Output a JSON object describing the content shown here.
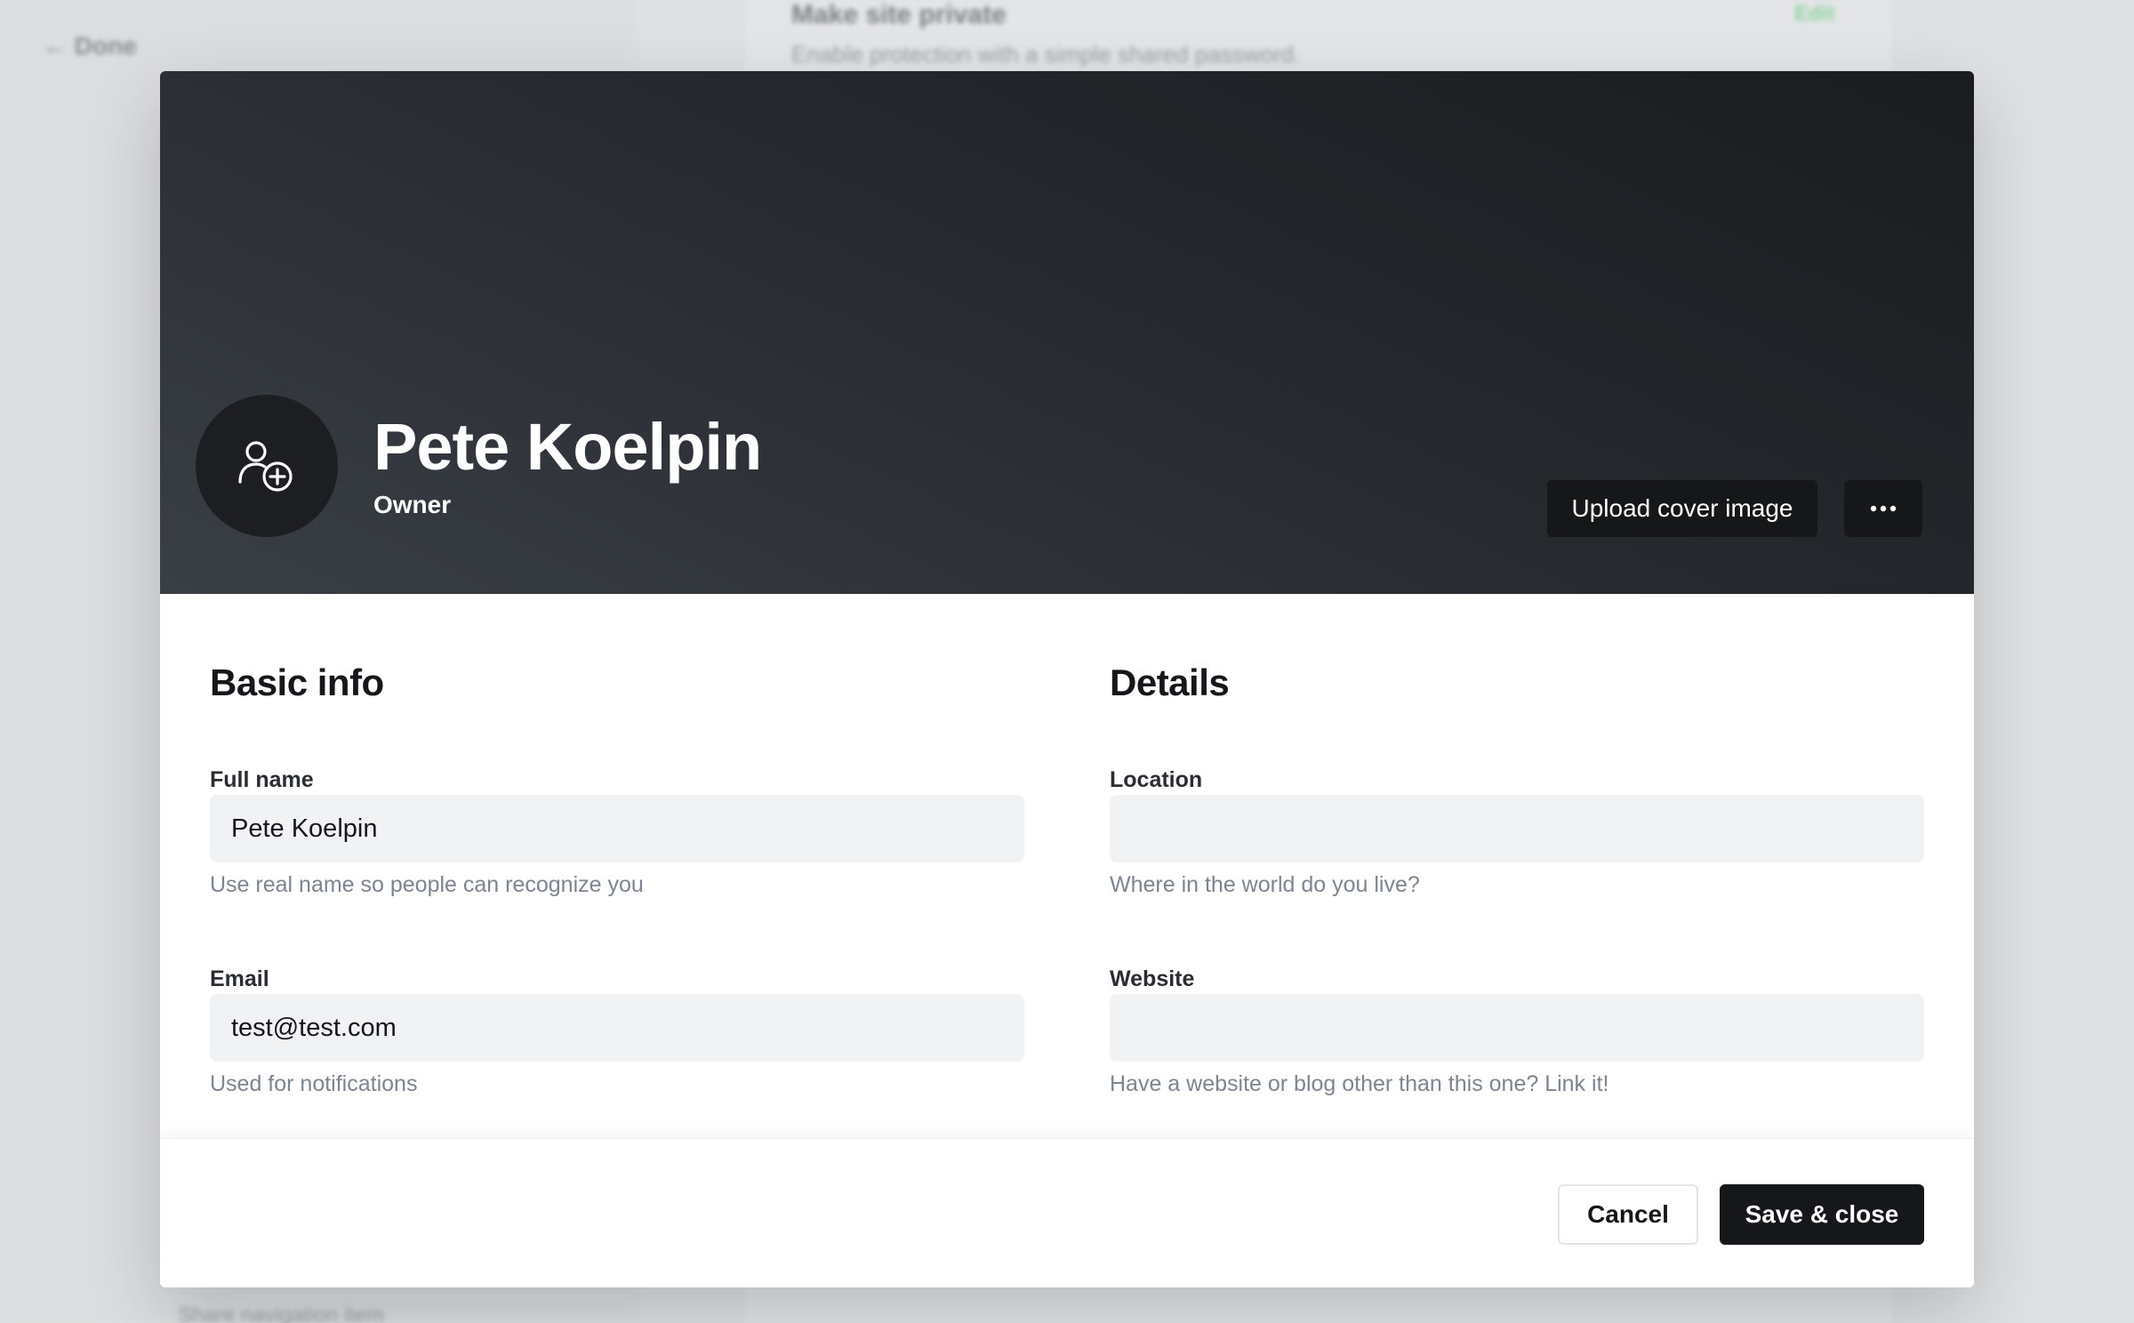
{
  "background": {
    "back_link": "← Done",
    "setting_title": "Make site private",
    "setting_description": "Enable protection with a simple shared password.",
    "setting_action": "Edit",
    "bottom_item": "Share navigation item"
  },
  "profile": {
    "name": "Pete Koelpin",
    "role": "Owner",
    "avatar_icon": "user-add-icon",
    "upload_cover_label": "Upload cover image",
    "more_icon": "ellipsis-icon"
  },
  "basic_info": {
    "title": "Basic info",
    "full_name": {
      "label": "Full name",
      "value": "Pete Koelpin",
      "hint": "Use real name so people can recognize you"
    },
    "email": {
      "label": "Email",
      "value": "test@test.com",
      "hint": "Used for notifications"
    }
  },
  "details": {
    "title": "Details",
    "location": {
      "label": "Location",
      "value": "",
      "hint": "Where in the world do you live?"
    },
    "website": {
      "label": "Website",
      "value": "",
      "hint": "Have a website or blog other than this one? Link it!"
    }
  },
  "footer": {
    "cancel_label": "Cancel",
    "save_label": "Save & close"
  },
  "colors": {
    "cover_dark": "#1a1c1f",
    "primary_button": "#15171a",
    "input_background": "#f1f2f3",
    "hint_text": "#7d8590",
    "accent_green": "#30cf43"
  }
}
